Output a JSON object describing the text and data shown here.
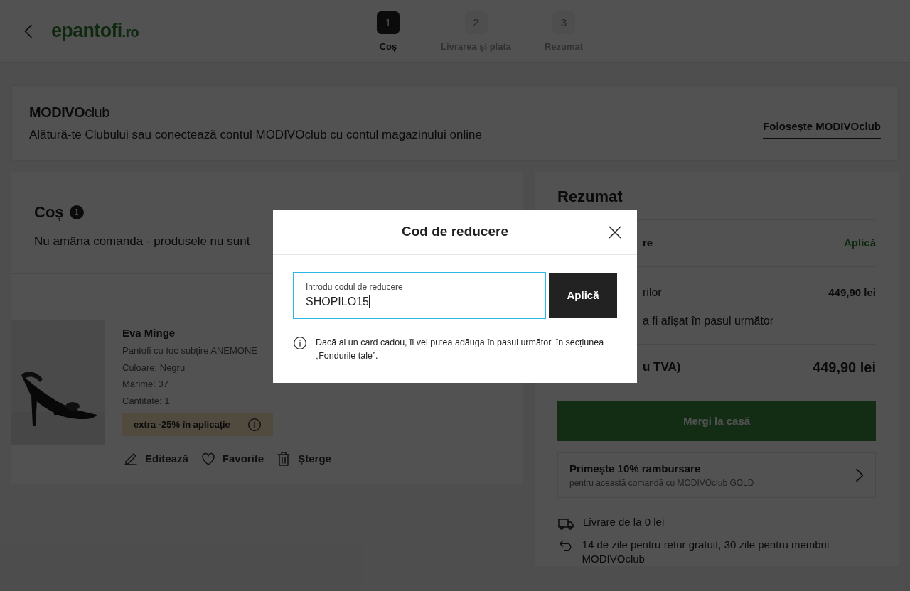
{
  "header": {
    "logo_main": "epantofi",
    "logo_suffix": ".ro",
    "steps": [
      {
        "number": "1",
        "label": "Coș",
        "selected": true
      },
      {
        "number": "2",
        "label": "Livrarea și plata",
        "selected": false
      },
      {
        "number": "3",
        "label": "Rezumat",
        "selected": false
      }
    ]
  },
  "club_banner": {
    "brand": "MODIVO",
    "brand_suffix": "club",
    "text": "Alătură-te Clubului sau conectează contul MODIVOclub cu contul magazinului online",
    "link": "Folosește MODIVOclub"
  },
  "cart": {
    "title": "Coș",
    "count": "1",
    "notice": "Nu amâna comanda - produsele nu sunt",
    "items": [
      {
        "kind": "picture",
        "brand": "Eva Minge",
        "name": "Pantofi cu toc subțire ANEMONE",
        "details": [
          "Culoare: Negru",
          "Mărime: 37",
          "Cantitate: 1"
        ],
        "promo": "extra -25% în aplicație",
        "actions": [
          "Editează",
          "Favorite",
          "Șterge"
        ]
      }
    ]
  },
  "summary": {
    "title": "Rezumat",
    "rows": [
      {
        "kind": "link",
        "label": "re",
        "value": "Aplică"
      },
      {
        "kind": "amount",
        "label": "rilor",
        "value": "449,90 lei"
      },
      {
        "kind": "note",
        "label": "a fi afișat în pasul următor"
      },
      {
        "kind": "total",
        "label": "u TVA)",
        "value": "449,90 lei"
      }
    ],
    "checkout": "Mergi la casă",
    "cashback": {
      "title": "Primește 10% rambursare",
      "subtitle": "pentru această comandă cu MODIVOclub GOLD"
    },
    "benefits": [
      {
        "kind": "delivery",
        "text": "Livrare de la 0 lei"
      },
      {
        "kind": "returns",
        "text": "14 de zile pentru retur gratuit, 30 zile pentru membrii MODIVOclub"
      }
    ]
  },
  "dialog": {
    "title": "Cod de reducere",
    "field": {
      "label": "Introdu codul de reducere",
      "value": "SHOPILO15",
      "focused": true
    },
    "apply": "Aplică",
    "note": "Dacă ai un card cadou, îl vei putea adăuga în pasul următor, în secțiunea „Fondurile tale”."
  }
}
